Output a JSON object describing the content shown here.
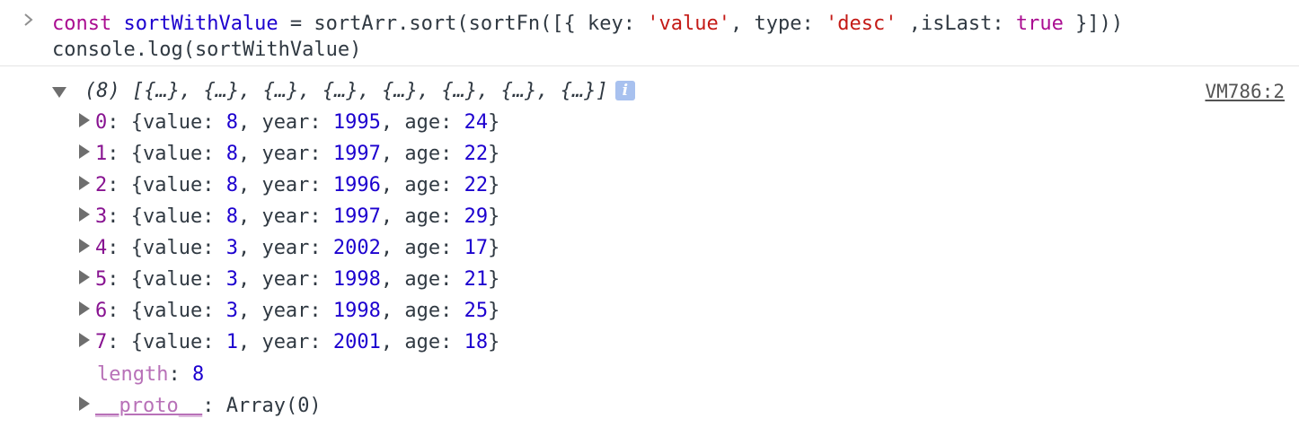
{
  "input": {
    "line1": {
      "kw_const": "const",
      "var_name": "sortWithValue",
      "rest1": " = sortArr.sort(sortFn([{ key: ",
      "str_value": "'value'",
      "rest2": ", type: ",
      "str_desc": "'desc'",
      "rest3": " ,isLast: ",
      "bool_true": "true",
      "rest4": " }]))"
    },
    "line2": "console.log(sortWithValue)"
  },
  "output": {
    "source_link": "VM786:2",
    "summary": "(8) [{…}, {…}, {…}, {…}, {…}, {…}, {…}, {…}]",
    "info_icon_glyph": "i",
    "entries": [
      {
        "index": "0",
        "value": "8",
        "year": "1995",
        "age": "24"
      },
      {
        "index": "1",
        "value": "8",
        "year": "1997",
        "age": "22"
      },
      {
        "index": "2",
        "value": "8",
        "year": "1996",
        "age": "22"
      },
      {
        "index": "3",
        "value": "8",
        "year": "1997",
        "age": "29"
      },
      {
        "index": "4",
        "value": "3",
        "year": "2002",
        "age": "17"
      },
      {
        "index": "5",
        "value": "3",
        "year": "1998",
        "age": "21"
      },
      {
        "index": "6",
        "value": "3",
        "year": "1998",
        "age": "25"
      },
      {
        "index": "7",
        "value": "1",
        "year": "2001",
        "age": "18"
      }
    ],
    "length_key": "length",
    "length_value": "8",
    "proto_key": "__proto__",
    "proto_value": "Array(0)"
  }
}
